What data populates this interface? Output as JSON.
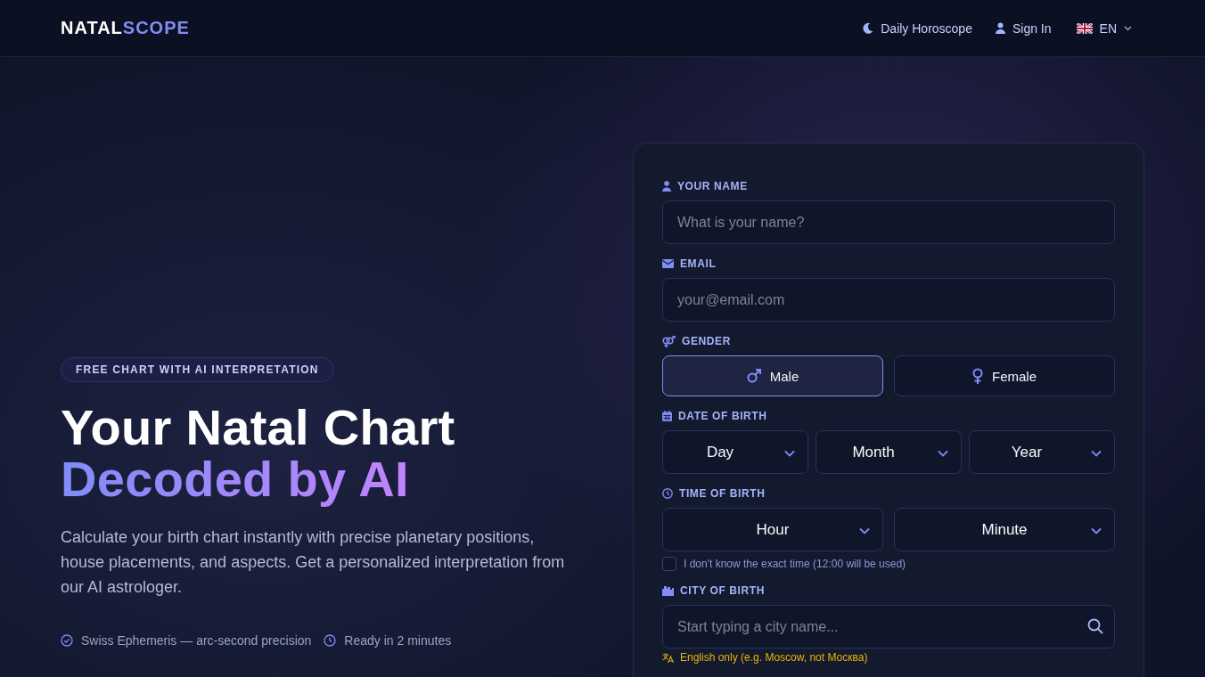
{
  "brand": {
    "part_1": "NATAL",
    "part_2": "SCOPE"
  },
  "nav": [
    {
      "kind": "moon",
      "label": "Daily Horoscope"
    },
    {
      "kind": "user",
      "label": "Sign In"
    }
  ],
  "language": {
    "code": "EN"
  },
  "hero": {
    "badge": "FREE CHART WITH AI INTERPRETATION",
    "title_line_1": "Your Natal Chart",
    "title_line_2": "Decoded by AI",
    "description": "Calculate your birth chart instantly with precise planetary positions, house placements, and aspects. Get a personalized interpretation from our AI astrologer.",
    "features": [
      {
        "kind": "check",
        "text": "Swiss Ephemeris — arc-second precision"
      },
      {
        "kind": "clock",
        "text": "Ready in 2 minutes"
      }
    ]
  },
  "form": {
    "name": {
      "label": "YOUR NAME",
      "placeholder": "What is your name?"
    },
    "email": {
      "label": "EMAIL",
      "placeholder": "your@email.com"
    },
    "gender": {
      "label": "GENDER",
      "options": [
        {
          "kind": "male",
          "label": "Male",
          "selected": true
        },
        {
          "kind": "female",
          "label": "Female",
          "selected": false
        }
      ]
    },
    "date_of_birth": {
      "label": "DATE OF BIRTH",
      "selects": [
        "Day",
        "Month",
        "Year"
      ]
    },
    "time_of_birth": {
      "label": "TIME OF BIRTH",
      "selects": [
        "Hour",
        "Minute"
      ],
      "unknown_time": {
        "label": "I don't know the exact time (12:00 will be used)",
        "checked": false
      }
    },
    "city": {
      "label": "CITY OF BIRTH",
      "placeholder": "Start typing a city name...",
      "hint": "English only (e.g. Moscow, not Москва)"
    }
  }
}
